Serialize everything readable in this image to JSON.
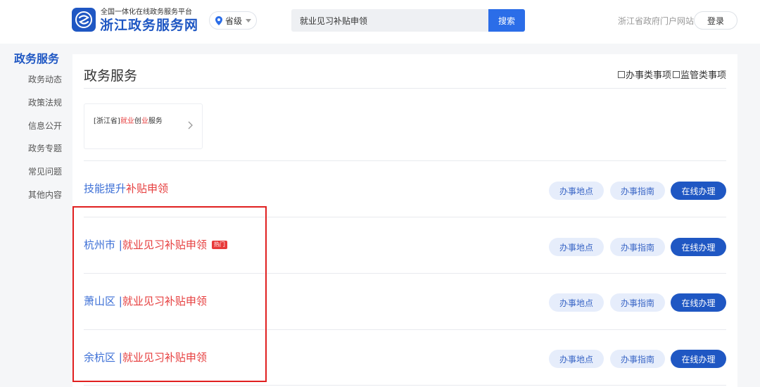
{
  "header": {
    "platform_subtitle": "全国一体化在线政务服务平台",
    "site_title": "浙江政务服务网",
    "region_label": "省级",
    "search_value": "就业见习补贴申领",
    "search_button": "搜索",
    "portal_link": "浙江省政府门户网站",
    "login_button": "登录",
    "brand_color": "#1f57c3"
  },
  "sidebar": {
    "title": "政务服务",
    "items": [
      {
        "label": "政务动态"
      },
      {
        "label": "政策法规"
      },
      {
        "label": "信息公开"
      },
      {
        "label": "政务专题"
      },
      {
        "label": "常见问题"
      },
      {
        "label": "其他内容"
      }
    ]
  },
  "main": {
    "title": "政务服务",
    "filters": [
      {
        "label": "办事类事项",
        "checked": false
      },
      {
        "label": "监管类事项",
        "checked": false
      }
    ],
    "service_card": {
      "prefix": "[浙江省]",
      "kw1": "就业",
      "mid": "创",
      "kw2": "业",
      "suffix": "服务"
    },
    "results": [
      {
        "place": "",
        "title_blue": "技能提升",
        "title_red": "补贴申领",
        "hot": false
      },
      {
        "place": "杭州市 | ",
        "title_blue": "",
        "title_red": "就业见习补贴申领",
        "hot": true,
        "hot_label": "热门"
      },
      {
        "place": "萧山区 | ",
        "title_blue": "",
        "title_red": "就业见习补贴申领",
        "hot": false
      },
      {
        "place": "余杭区 | ",
        "title_blue": "",
        "title_red": "就业见习补贴申领",
        "hot": false
      }
    ],
    "buttons": {
      "location": "办事地点",
      "guide": "办事指南",
      "online": "在线办理"
    }
  }
}
